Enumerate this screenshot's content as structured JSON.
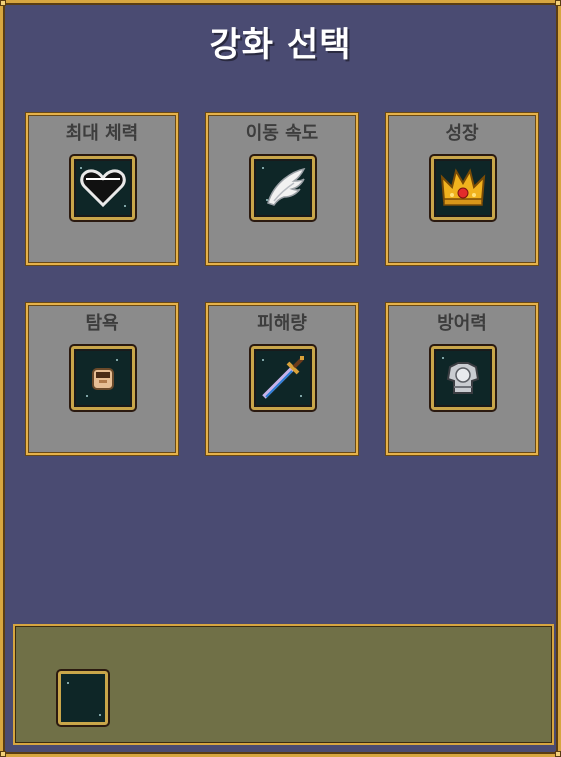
{
  "window": {
    "title": "강화 선택"
  },
  "upgrades": [
    {
      "label": "최대 체력",
      "icon": "heart-icon"
    },
    {
      "label": "이동 속도",
      "icon": "wing-icon"
    },
    {
      "label": "성장",
      "icon": "crown-icon"
    },
    {
      "label": "탐욕",
      "icon": "greed-bag-icon"
    },
    {
      "label": "피해량",
      "icon": "sword-icon"
    },
    {
      "label": "방어력",
      "icon": "armor-icon"
    }
  ],
  "colors": {
    "panel_bg": "#4a4b72",
    "frame_gold": "#d7a640",
    "card_bg": "#8b8b8b",
    "slot_bg": "#0e2627",
    "info_bg": "#707047"
  }
}
